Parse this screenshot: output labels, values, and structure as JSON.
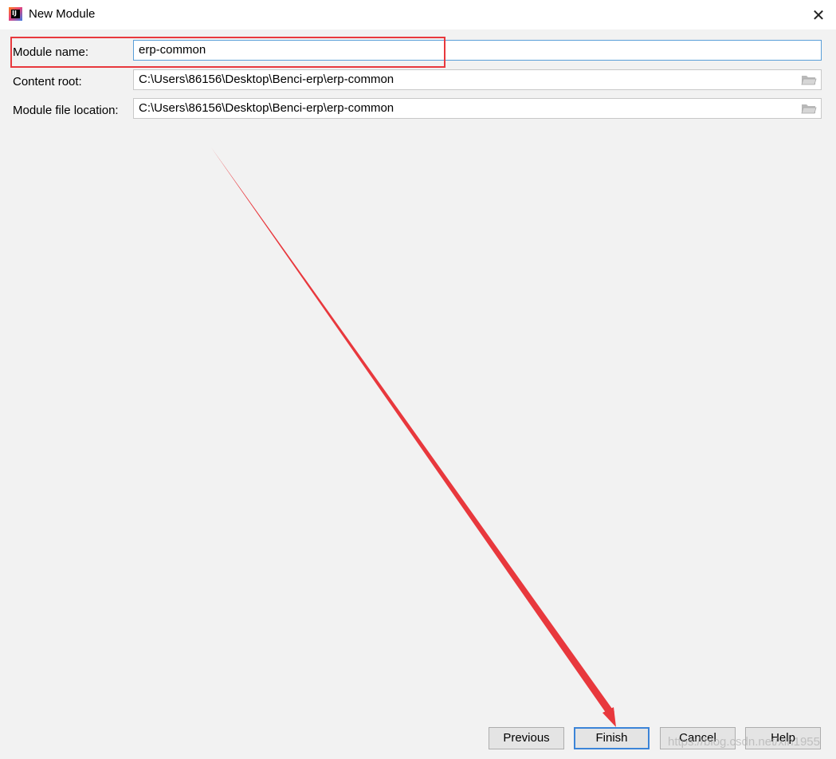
{
  "window": {
    "title": "New Module",
    "app_icon_letters": "IJ",
    "close_glyph": "✕"
  },
  "form": {
    "module_name": {
      "label": "Module name:",
      "value": "erp-common"
    },
    "content_root": {
      "label": "Content root:",
      "value": "C:\\Users\\86156\\Desktop\\Benci-erp\\erp-common"
    },
    "module_file_location": {
      "label": "Module file location:",
      "value": "C:\\Users\\86156\\Desktop\\Benci-erp\\erp-common"
    }
  },
  "buttons": {
    "previous": "Previous",
    "finish": "Finish",
    "cancel": "Cancel",
    "help": "Help"
  },
  "watermark": "https://blog.csdn.net/xlh1955",
  "annotation": {
    "color": "#e8383d",
    "icon": "red-arrow"
  }
}
